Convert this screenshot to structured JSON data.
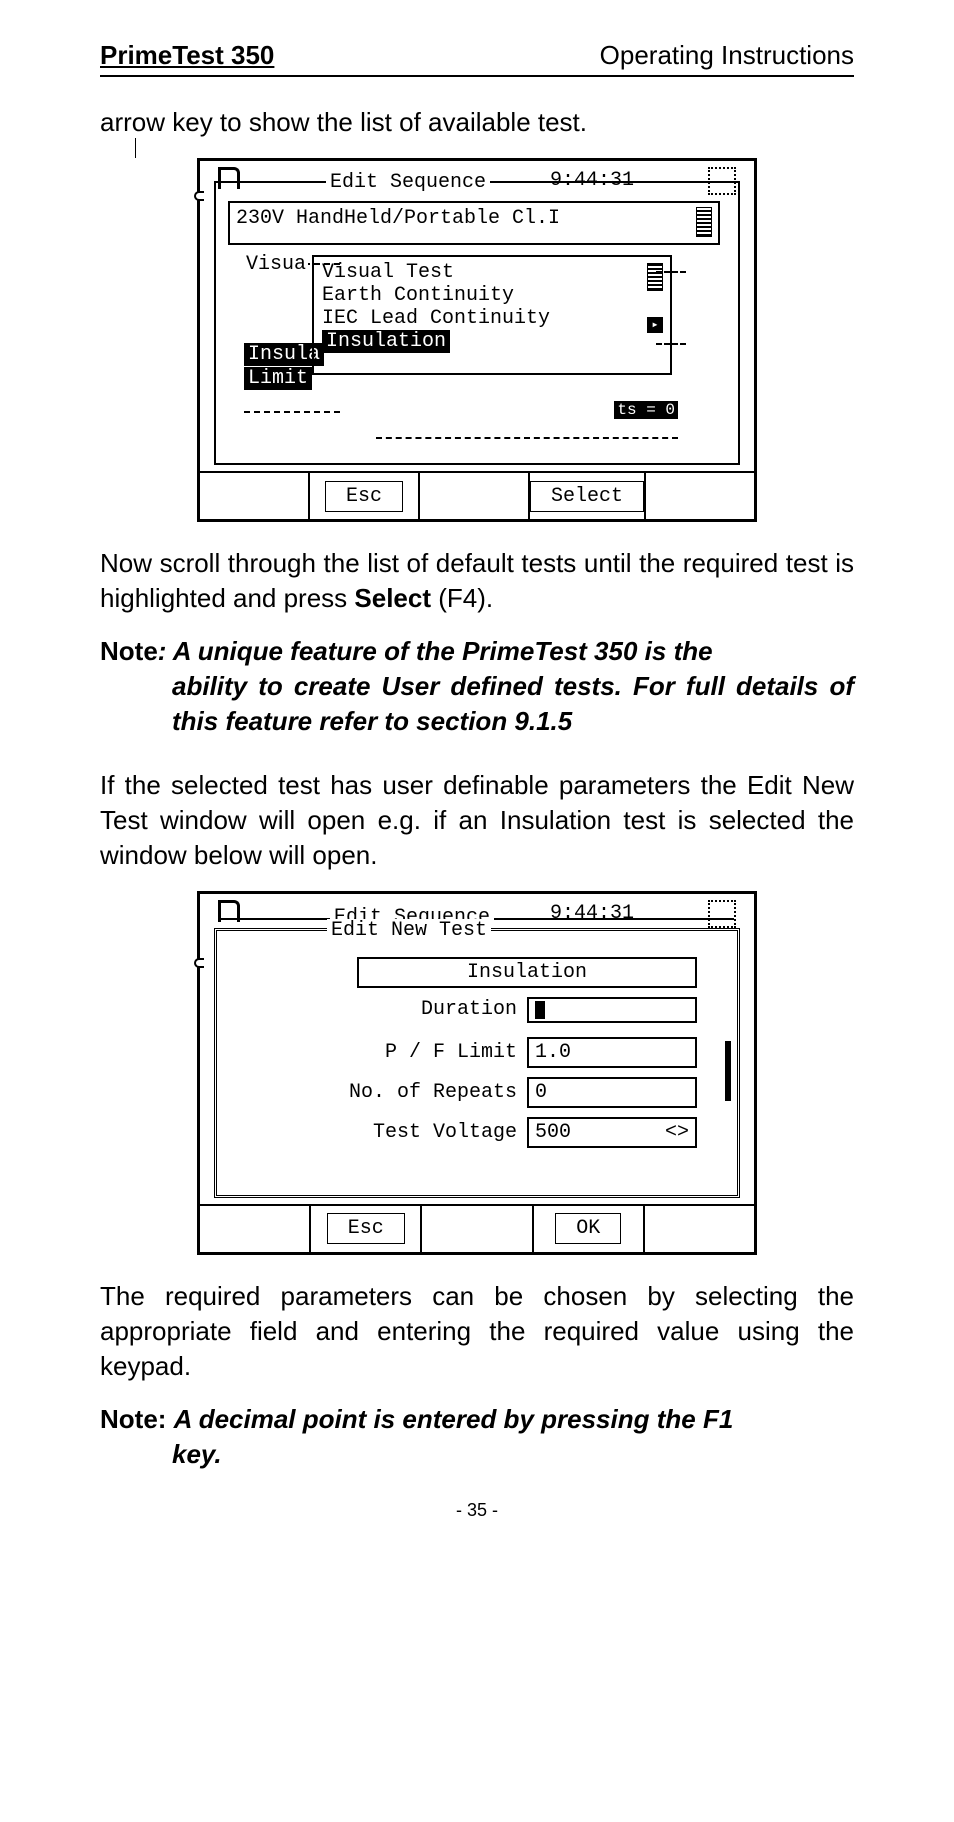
{
  "header": {
    "left": "PrimeTest 350",
    "right": "Operating Instructions"
  },
  "intro": "arrow key to show the list of available test.",
  "screen1": {
    "clock": "9:44:31",
    "title": "Edit Sequence",
    "panel_text": "230V HandHeld/Portable Cl.I",
    "side_visual": "Visua",
    "side_insula": "Insula",
    "side_limit": "Limit",
    "list": {
      "item1": "Visual Test",
      "item2": "Earth Continuity",
      "item3": "IEC Lead Continuity",
      "item4": "Insulation"
    },
    "ts": "ts = 0",
    "btn_esc": "Esc",
    "btn_select": "Select"
  },
  "para2": "Now scroll through the list of default tests until the required test is highlighted and press ",
  "para2_bold": "Select",
  "para2_tail": " (F4).",
  "note1": {
    "label": "Note",
    "text_line1": ": A unique feature of the PrimeTest 350 is the",
    "text_line2": "ability to create User defined tests. For full details of this feature refer to section 9.1.5"
  },
  "para3": "If the selected test has user definable parameters the Edit New Test window will open e.g. if an Insulation test is selected the window below will open.",
  "screen2": {
    "clock": "9:44:31",
    "title_a": "Edit Sequence",
    "title_b": "Edit New Test",
    "field_title": "Insulation",
    "duration_lbl": "Duration",
    "pf_lbl": "P / F Limit",
    "pf_val": "1.0",
    "rep_lbl": "No. of Repeats",
    "rep_val": "0",
    "volt_lbl": "Test Voltage",
    "volt_val": "500",
    "volt_arrows": "<>",
    "btn_esc": "Esc",
    "btn_ok": "OK"
  },
  "para4": "The required parameters can be chosen by selecting the appropriate field and entering the required value using the keypad.",
  "note2": {
    "label": "Note: ",
    "text_line1": "A decimal point is entered by pressing the F1",
    "text_line2": "key."
  },
  "page": "- 35 -"
}
